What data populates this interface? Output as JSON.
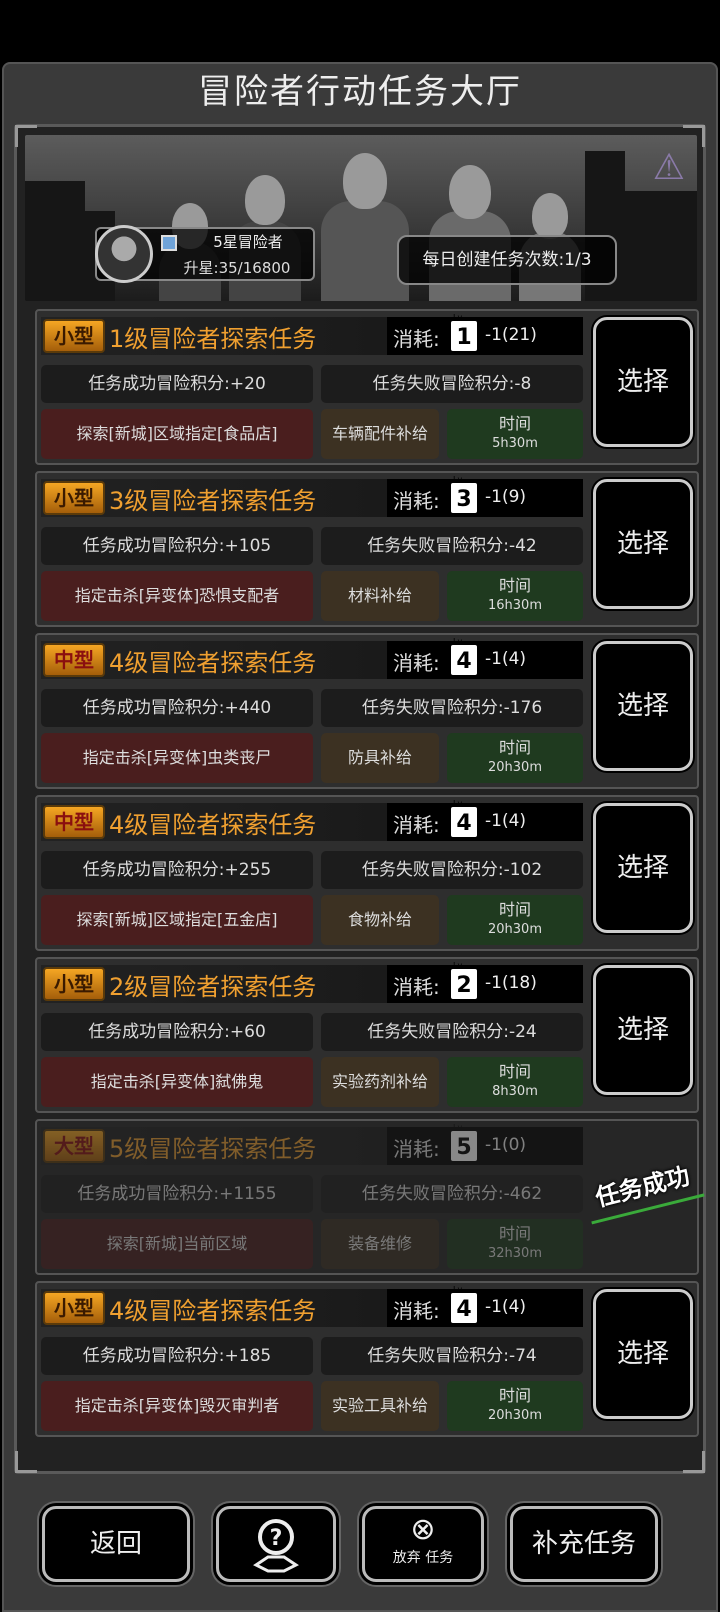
{
  "header": {
    "title": "冒险者行动任务大厅"
  },
  "profile": {
    "rank": "5星冒险者",
    "progress": "升星:35/16800"
  },
  "daily": {
    "text": "每日创建任务次数:1/3"
  },
  "tasks": [
    {
      "type": "小型",
      "title": "1级冒险者探索任务",
      "cost_label": "消耗:",
      "lv": "1",
      "cost": "-1(21)",
      "success": "任务成功冒险积分:+20",
      "fail": "任务失败冒险积分:-8",
      "desc": "探索[新城]区域指定[食品店]",
      "reward": "车辆配件补给",
      "time_label": "时间",
      "time": "5h30m",
      "button": "选择"
    },
    {
      "type": "小型",
      "title": "3级冒险者探索任务",
      "cost_label": "消耗:",
      "lv": "3",
      "cost": "-1(9)",
      "success": "任务成功冒险积分:+105",
      "fail": "任务失败冒险积分:-42",
      "desc": "指定击杀[异变体]恐惧支配者",
      "reward": "材料补给",
      "time_label": "时间",
      "time": "16h30m",
      "button": "选择"
    },
    {
      "type": "中型",
      "title": "4级冒险者探索任务",
      "cost_label": "消耗:",
      "lv": "4",
      "cost": "-1(4)",
      "success": "任务成功冒险积分:+440",
      "fail": "任务失败冒险积分:-176",
      "desc": "指定击杀[异变体]虫类丧尸",
      "reward": "防具补给",
      "time_label": "时间",
      "time": "20h30m",
      "button": "选择"
    },
    {
      "type": "中型",
      "title": "4级冒险者探索任务",
      "cost_label": "消耗:",
      "lv": "4",
      "cost": "-1(4)",
      "success": "任务成功冒险积分:+255",
      "fail": "任务失败冒险积分:-102",
      "desc": "探索[新城]区域指定[五金店]",
      "reward": "食物补给",
      "time_label": "时间",
      "time": "20h30m",
      "button": "选择"
    },
    {
      "type": "小型",
      "title": "2级冒险者探索任务",
      "cost_label": "消耗:",
      "lv": "2",
      "cost": "-1(18)",
      "success": "任务成功冒险积分:+60",
      "fail": "任务失败冒险积分:-24",
      "desc": "指定击杀[异变体]弑佛鬼",
      "reward": "实验药剂补给",
      "time_label": "时间",
      "time": "8h30m",
      "button": "选择"
    },
    {
      "type": "大型",
      "title": "5级冒险者探索任务",
      "cost_label": "消耗:",
      "lv": "5",
      "cost": "-1(0)",
      "success": "任务成功冒险积分:+1155",
      "fail": "任务失败冒险积分:-462",
      "desc": "探索[新城]当前区域",
      "reward": "装备维修",
      "time_label": "时间",
      "time": "32h30m",
      "stamp": "任务成功"
    },
    {
      "type": "小型",
      "title": "4级冒险者探索任务",
      "cost_label": "消耗:",
      "lv": "4",
      "cost": "-1(4)",
      "success": "任务成功冒险积分:+185",
      "fail": "任务失败冒险积分:-74",
      "desc": "指定击杀[异变体]毁灭审判者",
      "reward": "实验工具补给",
      "time_label": "时间",
      "time": "20h30m",
      "button": "选择"
    }
  ],
  "footer": {
    "back": "返回",
    "help_icon": "question-map-icon",
    "abandon_icon": "close-circle-icon",
    "abandon": "放弃 任务",
    "refill": "补充任务"
  }
}
